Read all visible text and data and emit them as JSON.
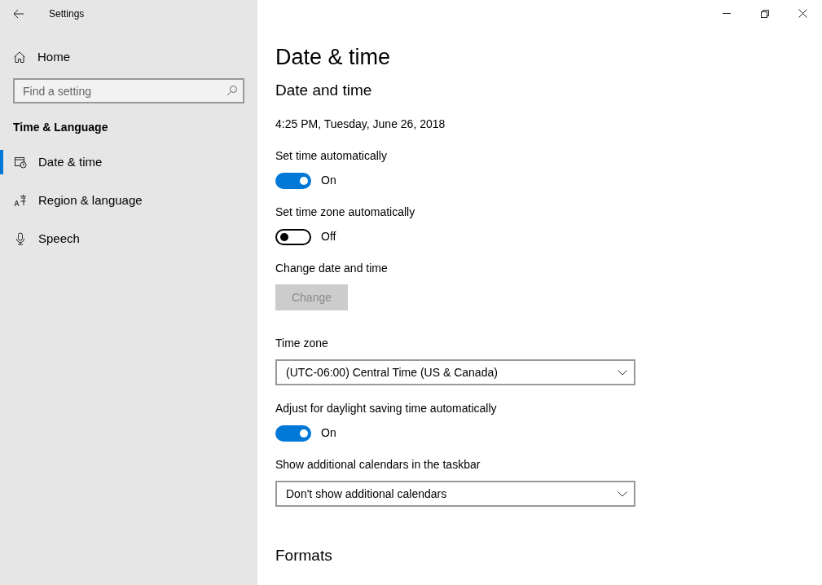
{
  "window": {
    "title": "Settings"
  },
  "sidebar": {
    "home": "Home",
    "search": {
      "placeholder": "Find a setting"
    },
    "group": "Time & Language",
    "items": [
      {
        "label": "Date & time",
        "kind": "calendar",
        "selected": true
      },
      {
        "label": "Region & language",
        "kind": "language",
        "selected": false
      },
      {
        "label": "Speech",
        "kind": "mic",
        "selected": false
      }
    ]
  },
  "page": {
    "title": "Date & time",
    "section": "Date and time",
    "current": "4:25 PM, Tuesday, June 26, 2018",
    "settings": [
      {
        "kind": "toggle",
        "label": "Set time automatically",
        "on": true,
        "state": "On"
      },
      {
        "kind": "toggle",
        "label": "Set time zone automatically",
        "on": false,
        "state": "Off"
      },
      {
        "kind": "button",
        "label": "Change date and time",
        "button": "Change",
        "disabled": true
      },
      {
        "kind": "dropdown",
        "label": "Time zone",
        "value": "(UTC-06:00) Central Time (US & Canada)"
      },
      {
        "kind": "toggle",
        "label": "Adjust for daylight saving time automatically",
        "on": true,
        "state": "On"
      },
      {
        "kind": "dropdown",
        "label": "Show additional calendars in the taskbar",
        "value": "Don't show additional calendars"
      }
    ],
    "next_section": "Formats"
  }
}
